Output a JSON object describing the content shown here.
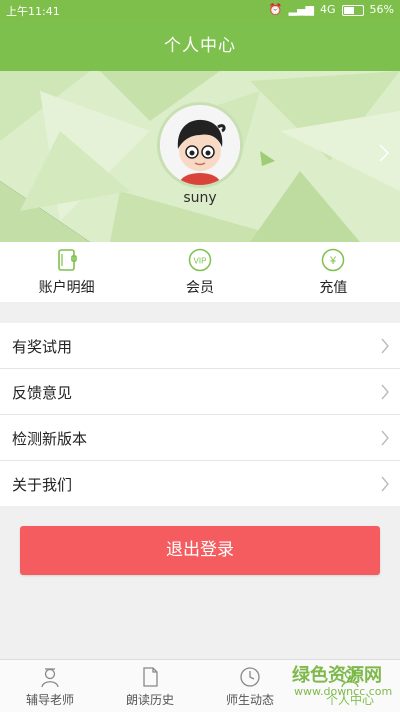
{
  "status_bar": {
    "time": "上午11:41",
    "network": "4G",
    "battery": "56%"
  },
  "header": {
    "title": "个人中心"
  },
  "profile": {
    "username": "suny"
  },
  "actions": [
    {
      "label": "账户明细",
      "icon": "wallet-icon"
    },
    {
      "label": "会员",
      "icon": "vip-icon",
      "badge": "VIP"
    },
    {
      "label": "充值",
      "icon": "yen-coin-icon",
      "badge": "¥"
    }
  ],
  "menu": [
    {
      "label": "有奖试用"
    },
    {
      "label": "反馈意见"
    },
    {
      "label": "检测新版本"
    },
    {
      "label": "关于我们"
    }
  ],
  "logout_label": "退出登录",
  "tabs": [
    {
      "label": "辅导老师",
      "icon": "teacher-icon"
    },
    {
      "label": "朗读历史",
      "icon": "document-icon"
    },
    {
      "label": "师生动态",
      "icon": "clock-icon"
    },
    {
      "label": "个人中心",
      "icon": "profile-icon",
      "active": true
    }
  ],
  "watermark": {
    "title": "绿色资源网",
    "url": "www.downcc.com"
  },
  "colors": {
    "primary_green": "#7ec04d",
    "logout_red": "#f45c5f",
    "banner_bg": "#d9ecc6"
  }
}
